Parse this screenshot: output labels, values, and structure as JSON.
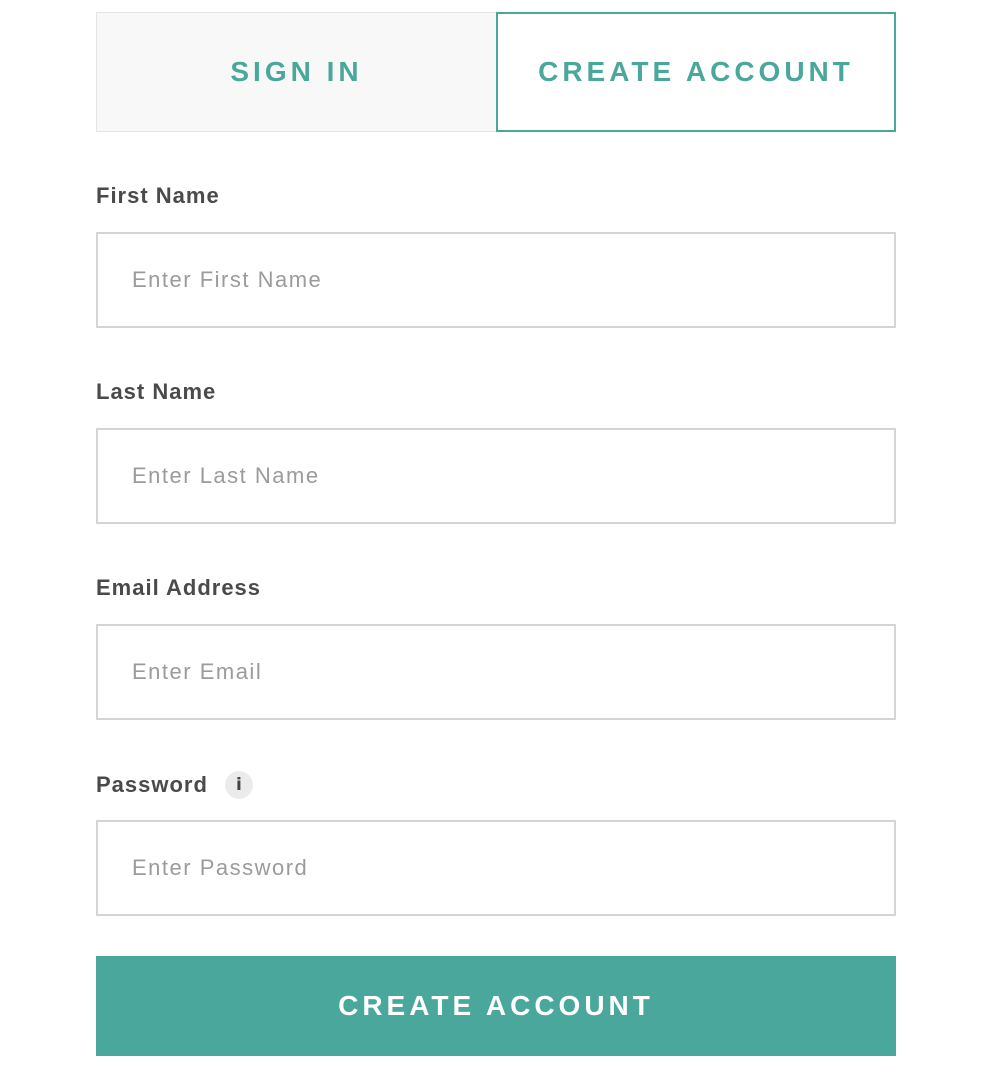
{
  "colors": {
    "accent": "#4aa79b",
    "label_text": "#4a4a4a",
    "placeholder_text": "#9b9b9b",
    "input_border": "#d5d5d5",
    "inactive_tab_bg": "#f8f8f8"
  },
  "tabs": [
    {
      "label": "SIGN IN",
      "active": false
    },
    {
      "label": "CREATE ACCOUNT",
      "active": true
    }
  ],
  "form": {
    "first_name": {
      "label": "First Name",
      "placeholder": "Enter First Name",
      "value": ""
    },
    "last_name": {
      "label": "Last Name",
      "placeholder": "Enter Last Name",
      "value": ""
    },
    "email": {
      "label": "Email Address",
      "placeholder": "Enter Email",
      "value": ""
    },
    "password": {
      "label": "Password",
      "placeholder": "Enter Password",
      "value": "",
      "info_icon": "info-icon",
      "info_glyph": "i"
    }
  },
  "submit": {
    "label": "CREATE ACCOUNT"
  }
}
